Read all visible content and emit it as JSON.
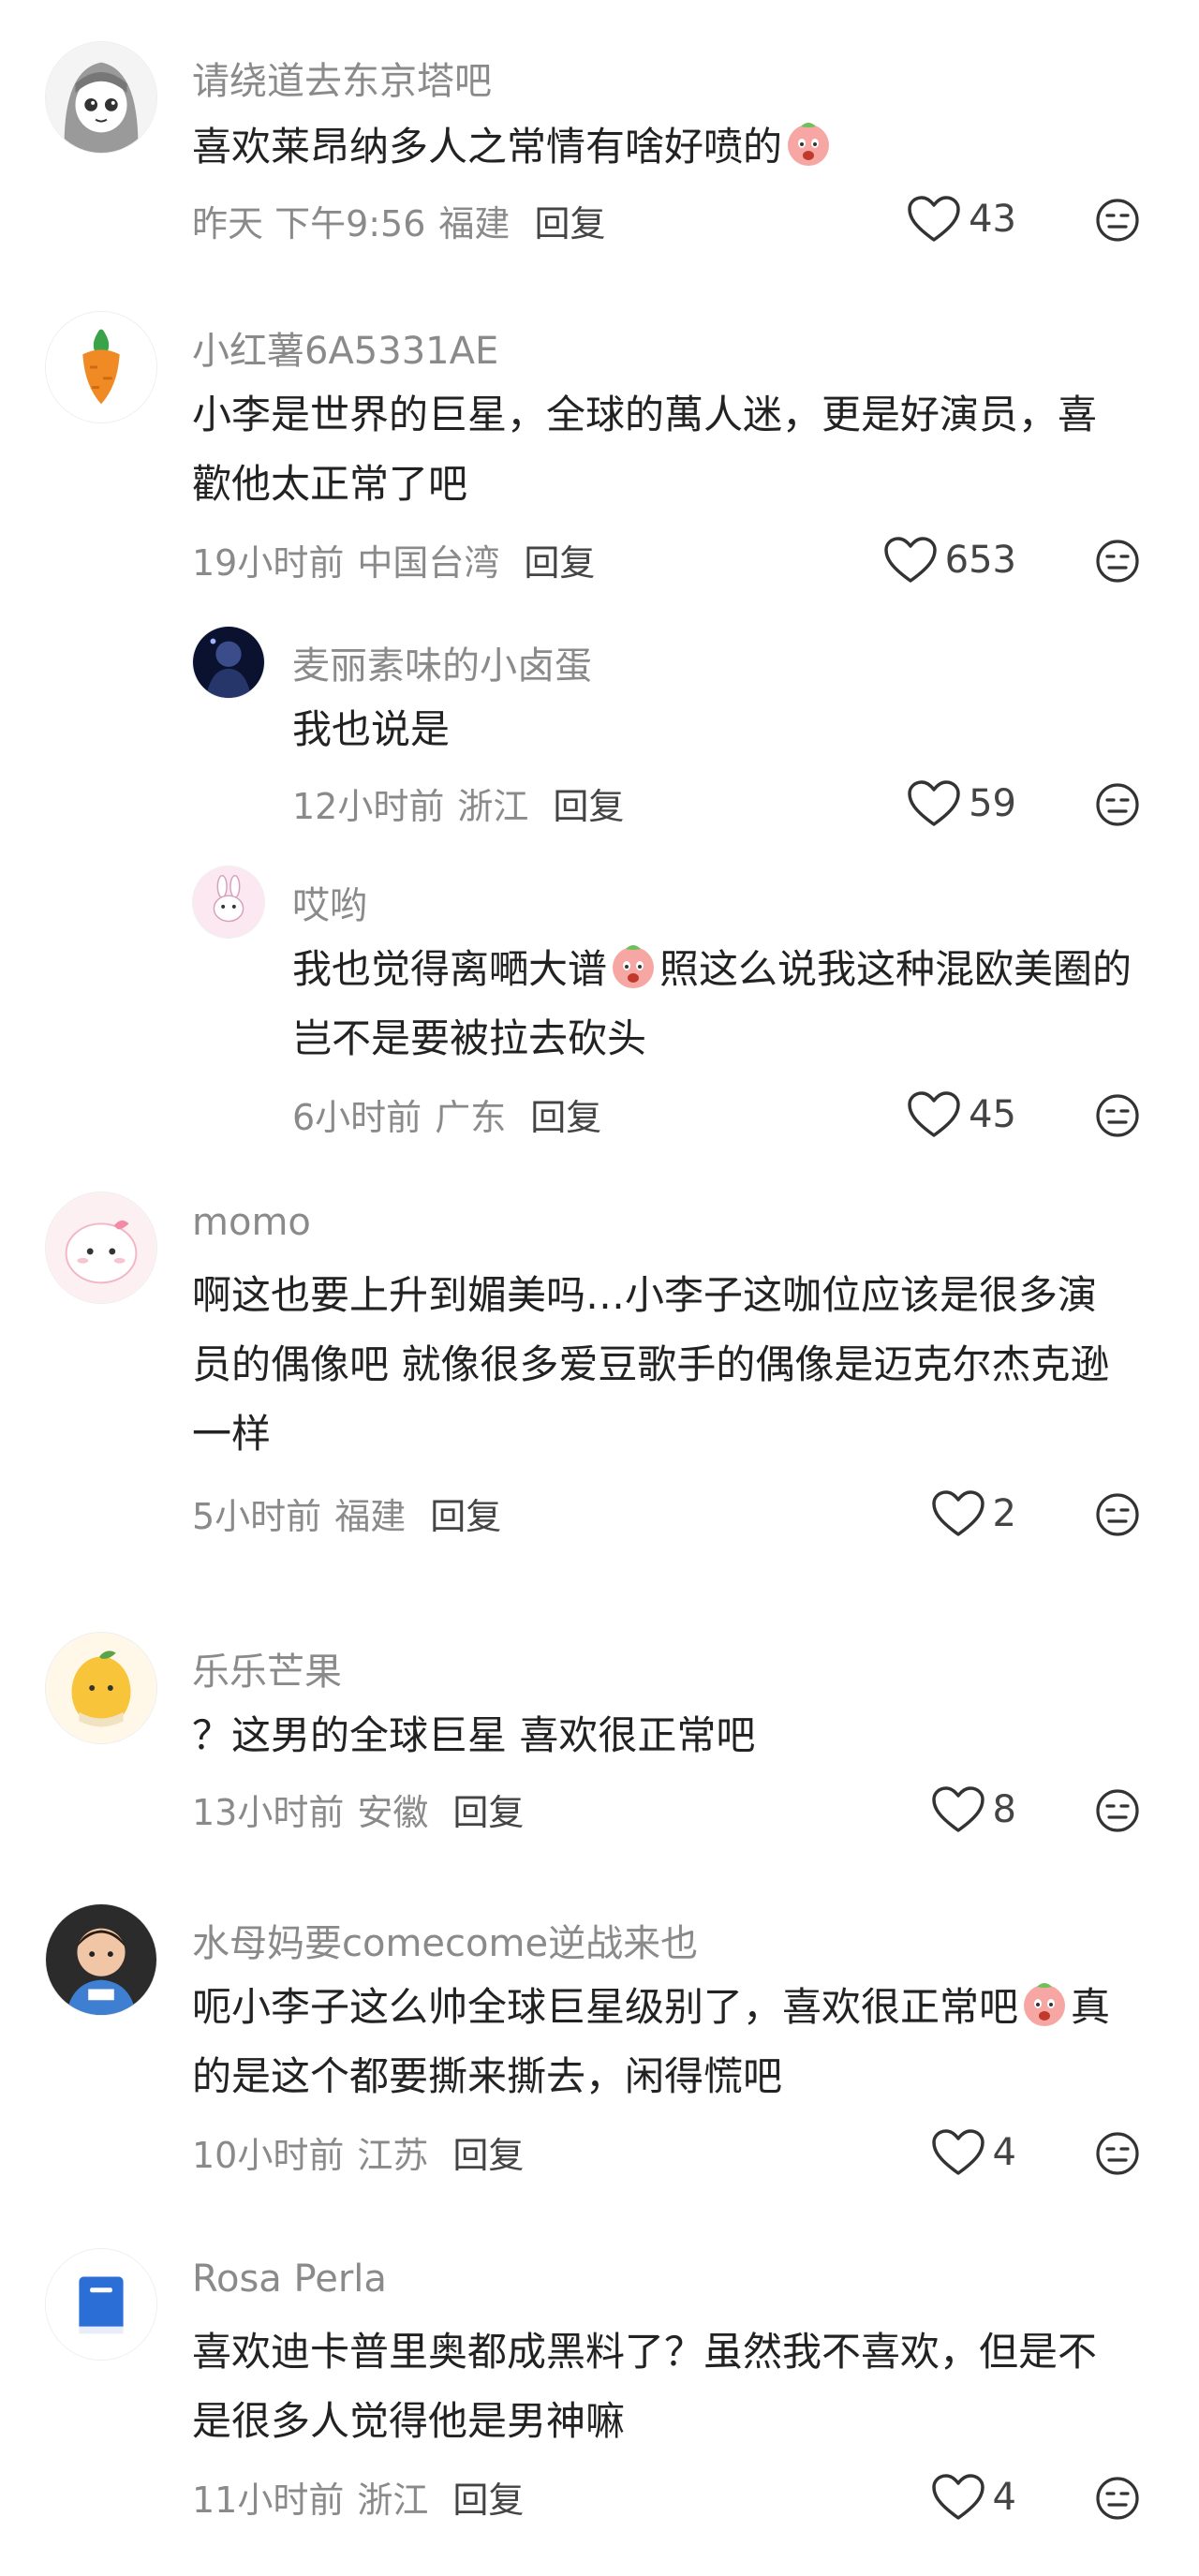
{
  "comments": [
    {
      "username": "请绕道去东京塔吧",
      "text": "喜欢莱昂纳多人之常情有啥好喷的",
      "time": "昨天 下午9:56",
      "location": "福建",
      "reply_label": "回复",
      "likes": "43",
      "avatar_icon": "cartoon-girl-icon"
    },
    {
      "username": "小红薯6A5331AE",
      "text": "小李是世界的巨星，全球的萬人迷，更是好演员，喜歡他太正常了吧",
      "time": "19小时前",
      "location": "中国台湾",
      "reply_label": "回复",
      "likes": "653",
      "avatar_icon": "carrot-icon",
      "replies": [
        {
          "username": "麦丽素味的小卤蛋",
          "text": "我也说是",
          "time": "12小时前",
          "location": "浙江",
          "reply_label": "回复",
          "likes": "59",
          "avatar_icon": "dark-figure-icon"
        },
        {
          "username": "哎哟",
          "text_before": "我也觉得离嗮大谱",
          "text_after": "照这么说我这种混欧美圈的岂不是要被拉去砍头",
          "time": "6小时前",
          "location": "广东",
          "reply_label": "回复",
          "likes": "45",
          "avatar_icon": "bunny-icon"
        }
      ]
    },
    {
      "username": "momo",
      "text": "啊这也要上升到媚美吗…小李子这咖位应该是很多演员的偶像吧 就像很多爱豆歌手的偶像是迈克尔杰克逊一样",
      "time": "5小时前",
      "location": "福建",
      "reply_label": "回复",
      "likes": "2",
      "avatar_icon": "pink-blob-icon"
    },
    {
      "username": "乐乐芒果",
      "text": "？这男的全球巨星 喜欢很正常吧",
      "time": "13小时前",
      "location": "安徽",
      "reply_label": "回复",
      "likes": "8",
      "avatar_icon": "mango-icon"
    },
    {
      "username": "水母妈要comecome逆战来也",
      "text_before": "呃小李子这么帅全球巨星级别了，喜欢很正常吧",
      "text_after": "真的是这个都要撕来撕去，闲得慌吧",
      "time": "10小时前",
      "location": "江苏",
      "reply_label": "回复",
      "likes": "4",
      "avatar_icon": "child-photo-icon"
    },
    {
      "username": "Rosa Perla",
      "text": "喜欢迪卡普里奥都成黑料了？虽然我不喜欢，但是不是很多人觉得他是男神嘛",
      "time": "11小时前",
      "location": "浙江",
      "reply_label": "回复",
      "likes": "4",
      "avatar_icon": "blue-book-icon"
    }
  ]
}
